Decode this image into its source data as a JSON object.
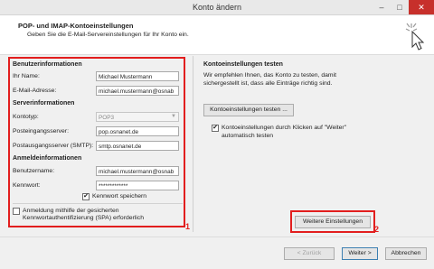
{
  "window": {
    "title": "Konto ändern"
  },
  "header": {
    "title": "POP- und IMAP-Kontoeinstellungen",
    "subtitle": "Geben Sie die E-Mail-Servereinstellungen für Ihr Konto ein."
  },
  "left": {
    "sections": {
      "user": "Benutzerinformationen",
      "server": "Serverinformationen",
      "login": "Anmeldeinformationen"
    },
    "labels": {
      "name": "Ihr Name:",
      "email": "E-Mail-Adresse:",
      "account_type": "Kontotyp:",
      "incoming": "Posteingangsserver:",
      "outgoing": "Postausgangsserver (SMTP):",
      "username": "Benutzername:",
      "password": "Kennwort:"
    },
    "values": {
      "name": "Michael Mustermann",
      "email": "michael.mustermann@osnab",
      "account_type": "POP3",
      "incoming": "pop.osnanet.de",
      "outgoing": "smtp.osnanet.de",
      "username": "michael.mustermann@osnab",
      "password": "*************"
    },
    "remember_password": "Kennwort speichern",
    "spa_line1": "Anmeldung mithilfe der gesicherten",
    "spa_line2": "Kennwortauthentifizierung (SPA) erforderlich",
    "badge": "1"
  },
  "right": {
    "title": "Kontoeinstellungen testen",
    "text_line1": "Wir empfehlen Ihnen, das Konto zu testen, damit",
    "text_line2": "sichergestellt ist, dass alle Einträge richtig sind.",
    "test_button": "Kontoeinstellungen testen ...",
    "auto_test_line1": "Kontoeinstellungen durch Klicken auf \"Weiter\"",
    "auto_test_line2": "automatisch testen",
    "more_settings_button": "Weitere Einstellungen",
    "badge": "2"
  },
  "footer": {
    "back": "< Zurück",
    "next": "Weiter >",
    "cancel": "Abbrechen"
  },
  "colors": {
    "highlight": "#e21e1e"
  },
  "checkbox_glyph": "✔"
}
